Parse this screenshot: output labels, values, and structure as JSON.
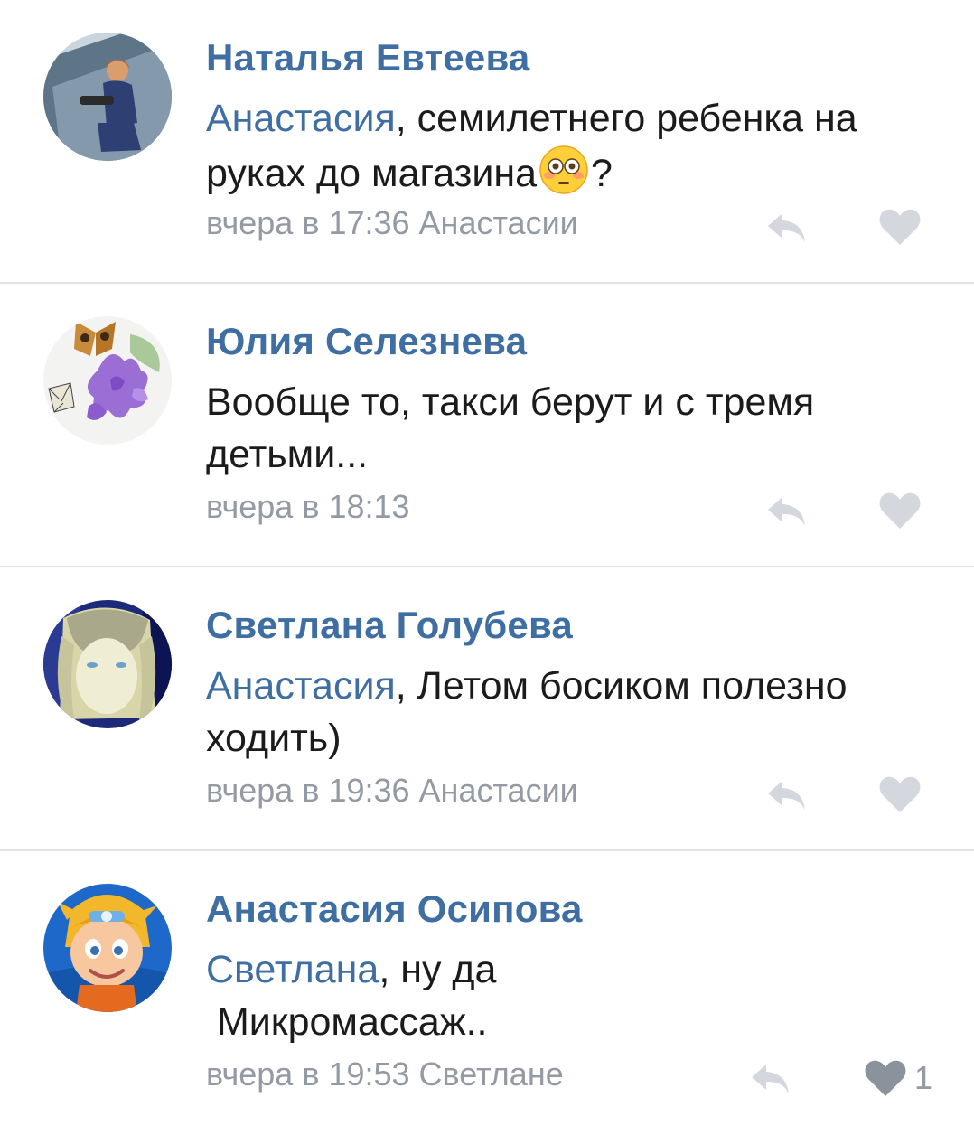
{
  "comments": [
    {
      "author": "Наталья Евтеева",
      "mention": "Анастасия",
      "text_before_emoji": ", семилетнего ребенка на руках до магазина",
      "text_after_emoji": "?",
      "emoji": "flushed-face",
      "meta": "вчера в 17:36 Анастасии",
      "likes": ""
    },
    {
      "author": "Юлия Селезнева",
      "mention": "",
      "text": "Вообще то, такси берут и с тремя детьми...",
      "meta": "вчера в 18:13",
      "likes": ""
    },
    {
      "author": "Светлана Голубева",
      "mention": "Анастасия",
      "text": ", Летом босиком полезно ходить)",
      "meta": "вчера в 19:36 Анастасии",
      "likes": ""
    },
    {
      "author": "Анастасия Осипова",
      "mention": "Светлана",
      "text": ", ну да",
      "text_line2": " Микромассаж..",
      "meta": "вчера в 19:53 Светлане",
      "likes": "1"
    }
  ],
  "icons": {
    "reply": "reply-arrow-icon",
    "like": "heart-icon"
  },
  "colors": {
    "link": "#3f6ea3",
    "meta": "#939aa3",
    "icon": "#d4d8de",
    "liked_icon": "#8a929b"
  }
}
